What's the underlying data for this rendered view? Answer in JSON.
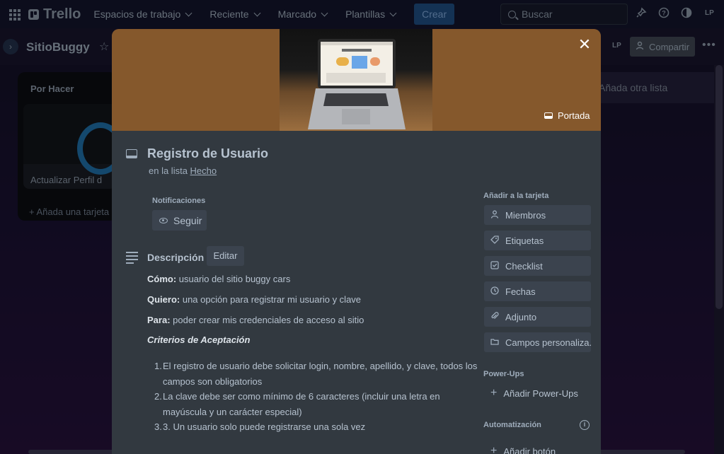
{
  "nav": {
    "logo": "Trello",
    "items": [
      "Espacios de trabajo",
      "Reciente",
      "Marcado",
      "Plantillas"
    ],
    "create": "Crear",
    "search_placeholder": "Buscar",
    "avatar": "LP"
  },
  "board": {
    "title": "SitioBuggy",
    "member": "LP",
    "share": "Compartir",
    "list_title": "Por Hacer",
    "list_card": "Actualizar Perfil d",
    "add_card": "Añada una tarjeta",
    "add_list": "Añada otra lista"
  },
  "card": {
    "cover_label": "Portada",
    "title": "Registro de Usuario",
    "in_list_prefix": "en la lista",
    "list_name": "Hecho",
    "notifications_label": "Notificaciones",
    "follow": "Seguir",
    "description_title": "Descripción",
    "edit": "Editar",
    "description": {
      "como_label": "Cómo:",
      "como": " usuario del sitio buggy cars",
      "quiero_label": "Quiero:",
      "quiero": " una opción para registrar mi usuario y clave",
      "para_label": "Para:",
      "para": " poder crear mis credenciales de acceso al sitio",
      "criteria": "Criterios de Aceptación",
      "items": [
        {
          "num": "1.",
          "text": "El registro de usuario debe solicitar login, nombre, apellido, y clave, todos los campos son obligatorios"
        },
        {
          "num": "2.",
          "text": "La clave debe ser como mínimo de 6 caracteres (incluir una letra en mayúscula y un carácter especial)"
        },
        {
          "num": "3.",
          "text": "3. Un usuario solo puede registrarse una sola vez"
        }
      ]
    },
    "sidebar": {
      "add_label": "Añadir a la tarjeta",
      "buttons": [
        "Miembros",
        "Etiquetas",
        "Checklist",
        "Fechas",
        "Adjunto",
        "Campos personaliza..."
      ],
      "powerups_label": "Power-Ups",
      "add_powerups": "Añadir Power-Ups",
      "automation_label": "Automatización",
      "add_button": "Añadir botón"
    }
  }
}
